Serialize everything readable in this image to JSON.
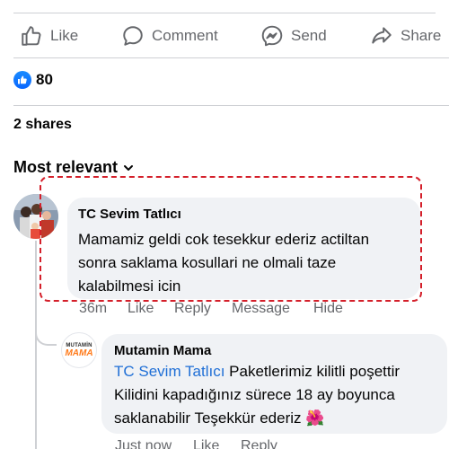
{
  "actions": {
    "like": "Like",
    "comment": "Comment",
    "send": "Send",
    "share": "Share"
  },
  "reactions": {
    "count": "80",
    "icon": "thumbs-up-icon"
  },
  "shares": "2 shares",
  "sort": {
    "label": "Most relevant",
    "icon": "chevron-down-icon"
  },
  "comments": [
    {
      "author": "TC Sevim Tatlıcı",
      "text": "Mamamiz geldi cok tesekkur ederiz actiltan sonra saklama kosullari ne olmali taze kalabilmesi icin",
      "time": "36m",
      "like": "Like",
      "reply": "Reply",
      "message": "Message",
      "hide": "Hide"
    }
  ],
  "reply": {
    "author": "Mutamin Mama",
    "avatar_top": "MUTAMİN",
    "avatar_bottom": "MAMA",
    "mention": "TC Sevim Tatlıcı",
    "text": "Paketlerimiz kilitli poşettir Kilidini kapadığınız sürece 18 ay boyunca saklanabilir Teşekkür ederiz",
    "emoji": "🌺",
    "time": "Just now",
    "like": "Like",
    "reply_label": "Reply"
  },
  "colors": {
    "accent": "#0866ff",
    "mention": "#1f6fd6",
    "highlight": "#d41f2a",
    "muted": "#65676b",
    "bubble": "#f0f2f5"
  }
}
